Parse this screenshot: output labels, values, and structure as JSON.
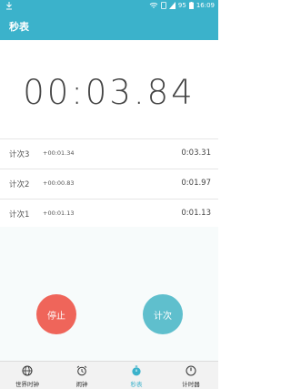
{
  "status": {
    "battery": "95",
    "time": "16:09"
  },
  "header": {
    "title": "秒表"
  },
  "stopwatch": {
    "display": "00:03.84"
  },
  "laps": [
    {
      "label": "计次3",
      "diff": "+00:01.34",
      "total": "0:03.31"
    },
    {
      "label": "计次2",
      "diff": "+00:00.83",
      "total": "0:01.97"
    },
    {
      "label": "计次1",
      "diff": "+00:01.13",
      "total": "0:01.13"
    }
  ],
  "buttons": {
    "stop": "停止",
    "lap": "计次"
  },
  "nav": [
    {
      "label": "世界时钟",
      "icon": "globe-icon"
    },
    {
      "label": "闹钟",
      "icon": "alarm-icon"
    },
    {
      "label": "秒表",
      "icon": "stopwatch-icon"
    },
    {
      "label": "计时器",
      "icon": "timer-icon"
    }
  ],
  "colors": {
    "primary": "#3bb2cb",
    "stop": "#ef655a",
    "lap": "#5fbfcd"
  }
}
